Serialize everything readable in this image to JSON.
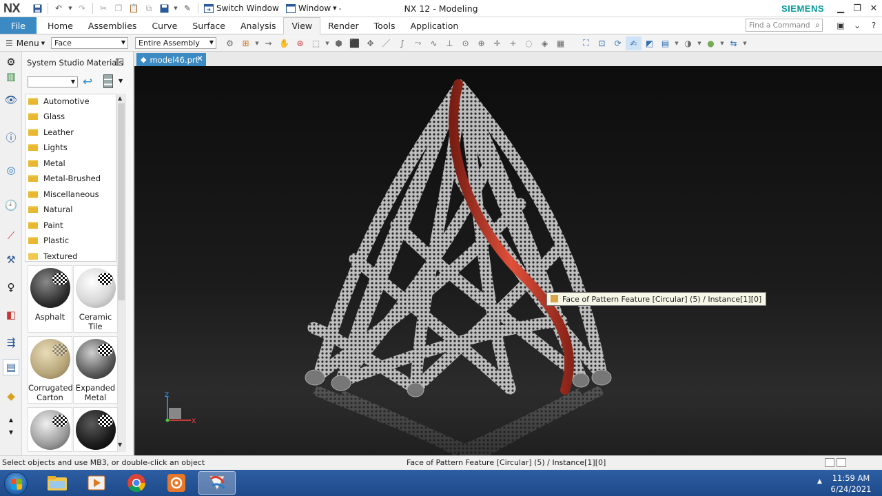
{
  "window": {
    "app_logo": "NX",
    "title": "NX 12 - Modeling",
    "brand": "SIEMENS",
    "brand_color": "#009999",
    "switch_window_label": "Switch Window",
    "window_menu_label": "Window"
  },
  "ribbon": {
    "file_label": "File",
    "tabs": [
      "Home",
      "Assemblies",
      "Curve",
      "Surface",
      "Analysis",
      "View",
      "Render",
      "Tools",
      "Application"
    ],
    "active_tab": "View",
    "find_command_placeholder": "Find a Command",
    "accent_color": "#3c8ac4"
  },
  "command_bar": {
    "menu_label": "Menu",
    "filter_type": "Face",
    "filter_scope": "Entire Assembly"
  },
  "materials_panel": {
    "title": "System Studio Materials",
    "folders": [
      "Automotive",
      "Glass",
      "Leather",
      "Lights",
      "Metal",
      "Metal-Brushed",
      "Miscellaneous",
      "Natural",
      "Paint",
      "Plastic",
      "Textured"
    ],
    "materials": [
      {
        "name": "Asphalt"
      },
      {
        "name": "Ceramic Tile"
      },
      {
        "name": "Corrugated Carton"
      },
      {
        "name": "Expanded Metal"
      }
    ]
  },
  "document": {
    "tab_name": "model46.prt"
  },
  "viewport": {
    "tooltip": "Face of Pattern Feature [Circular] (5) / Instance[1][0]",
    "axis_z": "Z",
    "axis_x": "X"
  },
  "status": {
    "prompt": "Select objects and use MB3, or double-click an object",
    "selection": "Face of Pattern Feature [Circular] (5) / Instance[1][0]"
  },
  "taskbar": {
    "time": "11:59 AM",
    "date": "6/24/2021"
  }
}
